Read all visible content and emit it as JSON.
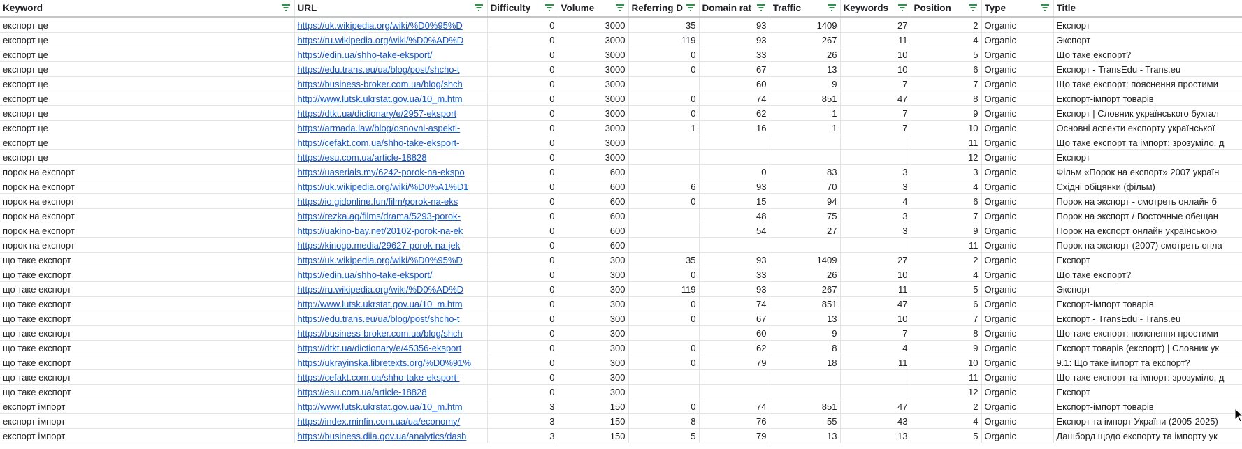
{
  "columns": [
    {
      "key": "keyword",
      "label": "Keyword"
    },
    {
      "key": "url",
      "label": "URL"
    },
    {
      "key": "difficulty",
      "label": "Difficulty"
    },
    {
      "key": "volume",
      "label": "Volume"
    },
    {
      "key": "referring",
      "label": "Referring D"
    },
    {
      "key": "domain_rating",
      "label": "Domain rat"
    },
    {
      "key": "traffic",
      "label": "Traffic"
    },
    {
      "key": "keywords",
      "label": "Keywords"
    },
    {
      "key": "position",
      "label": "Position"
    },
    {
      "key": "type",
      "label": "Type"
    },
    {
      "key": "title",
      "label": "Title"
    }
  ],
  "active_filter_column": "title",
  "filter_color_active": "#188038",
  "filter_color": "#188038",
  "link_color": "#1155cc",
  "rows": [
    [
      "експорт це",
      "https://uk.wikipedia.org/wiki/%D0%95%D",
      "0",
      "3000",
      "35",
      "93",
      "1409",
      "27",
      "2",
      "Organic",
      "Експорт"
    ],
    [
      "експорт це",
      "https://ru.wikipedia.org/wiki/%D0%AD%D",
      "0",
      "3000",
      "119",
      "93",
      "267",
      "11",
      "4",
      "Organic",
      "Экспорт"
    ],
    [
      "експорт це",
      "https://edin.ua/shho-take-eksport/",
      "0",
      "3000",
      "0",
      "33",
      "26",
      "10",
      "5",
      "Organic",
      "Що таке експорт?"
    ],
    [
      "експорт це",
      "https://edu.trans.eu/ua/blog/post/shcho-t",
      "0",
      "3000",
      "0",
      "67",
      "13",
      "10",
      "6",
      "Organic",
      "Експорт - TransEdu - Trans.eu"
    ],
    [
      "експорт це",
      "https://business-broker.com.ua/blog/shch",
      "0",
      "3000",
      "",
      "60",
      "9",
      "7",
      "7",
      "Organic",
      "Що таке експорт: пояснення простими"
    ],
    [
      "експорт це",
      "http://www.lutsk.ukrstat.gov.ua/10_m.htm",
      "0",
      "3000",
      "0",
      "74",
      "851",
      "47",
      "8",
      "Organic",
      "Експорт-імпорт товарів"
    ],
    [
      "експорт це",
      "https://dtkt.ua/dictionary/e/2957-eksport",
      "0",
      "3000",
      "0",
      "62",
      "1",
      "7",
      "9",
      "Organic",
      "Експорт | Словник українського бухгал"
    ],
    [
      "експорт це",
      "https://armada.law/blog/osnovni-aspekti-",
      "0",
      "3000",
      "1",
      "16",
      "1",
      "7",
      "10",
      "Organic",
      "Основні аспекти експорту української"
    ],
    [
      "експорт це",
      "https://cefakt.com.ua/shho-take-eksport-",
      "0",
      "3000",
      "",
      "",
      "",
      "",
      "11",
      "Organic",
      "Що таке експорт та імпорт: зрозуміло, д"
    ],
    [
      "експорт це",
      "https://esu.com.ua/article-18828",
      "0",
      "3000",
      "",
      "",
      "",
      "",
      "12",
      "Organic",
      "Експорт"
    ],
    [
      "порок на експорт",
      "https://uaserials.my/6242-porok-na-ekspo",
      "0",
      "600",
      "",
      "0",
      "83",
      "3",
      "3",
      "Organic",
      "Фільм «Порок на експорт» 2007 україн"
    ],
    [
      "порок на експорт",
      "https://uk.wikipedia.org/wiki/%D0%A1%D1",
      "0",
      "600",
      "6",
      "93",
      "70",
      "3",
      "4",
      "Organic",
      "Східні обіцянки (фільм)"
    ],
    [
      "порок на експорт",
      "https://io.gidonline.fun/film/porok-na-eks",
      "0",
      "600",
      "0",
      "15",
      "94",
      "4",
      "6",
      "Organic",
      "Порок на экспорт - смотреть онлайн б"
    ],
    [
      "порок на експорт",
      "https://rezka.ag/films/drama/5293-porok-",
      "0",
      "600",
      "",
      "48",
      "75",
      "3",
      "7",
      "Organic",
      "Порок на экспорт / Восточные обещан"
    ],
    [
      "порок на експорт",
      "https://uakino-bay.net/20102-porok-na-ek",
      "0",
      "600",
      "",
      "54",
      "27",
      "3",
      "9",
      "Organic",
      "Порок на експорт онлайн українською"
    ],
    [
      "порок на експорт",
      "https://kinogo.media/29627-porok-na-jek",
      "0",
      "600",
      "",
      "",
      "",
      "",
      "11",
      "Organic",
      "Порок на экспорт (2007) смотреть онла"
    ],
    [
      "що таке експорт",
      "https://uk.wikipedia.org/wiki/%D0%95%D",
      "0",
      "300",
      "35",
      "93",
      "1409",
      "27",
      "2",
      "Organic",
      "Експорт"
    ],
    [
      "що таке експорт",
      "https://edin.ua/shho-take-eksport/",
      "0",
      "300",
      "0",
      "33",
      "26",
      "10",
      "4",
      "Organic",
      "Що таке експорт?"
    ],
    [
      "що таке експорт",
      "https://ru.wikipedia.org/wiki/%D0%AD%D",
      "0",
      "300",
      "119",
      "93",
      "267",
      "11",
      "5",
      "Organic",
      "Экспорт"
    ],
    [
      "що таке експорт",
      "http://www.lutsk.ukrstat.gov.ua/10_m.htm",
      "0",
      "300",
      "0",
      "74",
      "851",
      "47",
      "6",
      "Organic",
      "Експорт-імпорт товарів"
    ],
    [
      "що таке експорт",
      "https://edu.trans.eu/ua/blog/post/shcho-t",
      "0",
      "300",
      "0",
      "67",
      "13",
      "10",
      "7",
      "Organic",
      "Експорт - TransEdu - Trans.eu"
    ],
    [
      "що таке експорт",
      "https://business-broker.com.ua/blog/shch",
      "0",
      "300",
      "",
      "60",
      "9",
      "7",
      "8",
      "Organic",
      "Що таке експорт: пояснення простими"
    ],
    [
      "що таке експорт",
      "https://dtkt.ua/dictionary/e/45356-eksport",
      "0",
      "300",
      "0",
      "62",
      "8",
      "4",
      "9",
      "Organic",
      "Експорт товарів (експорт) | Словник ук"
    ],
    [
      "що таке експорт",
      "https://ukrayinska.libretexts.org/%D0%91%",
      "0",
      "300",
      "0",
      "79",
      "18",
      "11",
      "10",
      "Organic",
      "9.1: Що таке імпорт та експорт?"
    ],
    [
      "що таке експорт",
      "https://cefakt.com.ua/shho-take-eksport-",
      "0",
      "300",
      "",
      "",
      "",
      "",
      "11",
      "Organic",
      "Що таке експорт та імпорт: зрозуміло, д"
    ],
    [
      "що таке експорт",
      "https://esu.com.ua/article-18828",
      "0",
      "300",
      "",
      "",
      "",
      "",
      "12",
      "Organic",
      "Експорт"
    ],
    [
      "експорт імпорт",
      "http://www.lutsk.ukrstat.gov.ua/10_m.htm",
      "3",
      "150",
      "0",
      "74",
      "851",
      "47",
      "2",
      "Organic",
      "Експорт-імпорт товарів"
    ],
    [
      "експорт імпорт",
      "https://index.minfin.com.ua/ua/economy/",
      "3",
      "150",
      "8",
      "76",
      "55",
      "43",
      "4",
      "Organic",
      "Експорт та імпорт України (2005-2025)"
    ],
    [
      "експорт імпорт",
      "https://business.diia.gov.ua/analytics/dash",
      "3",
      "150",
      "5",
      "79",
      "13",
      "13",
      "5",
      "Organic",
      "Дашборд щодо експорту та імпорту ук"
    ]
  ]
}
